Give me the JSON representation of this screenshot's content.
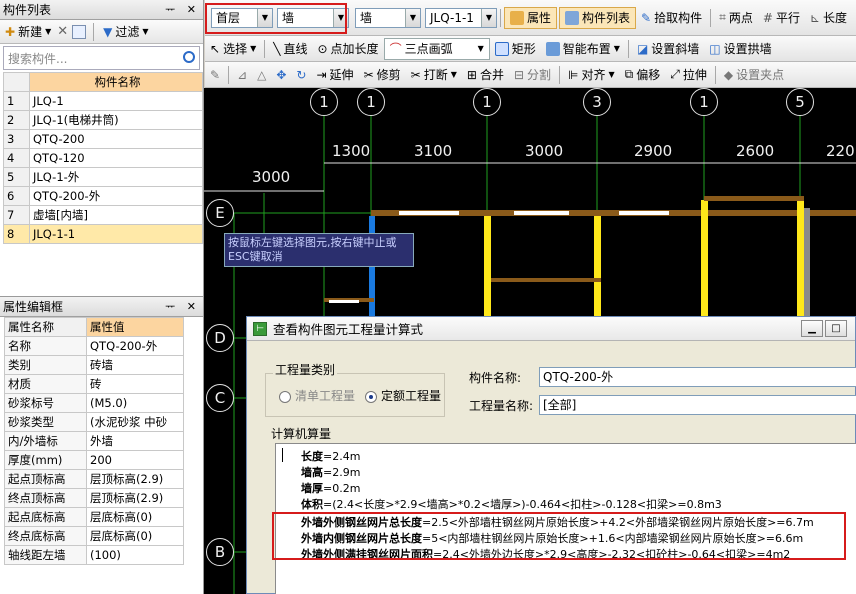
{
  "components_panel": {
    "title": "构件列表",
    "pin": "ᅲ ✕",
    "toolbar": {
      "new_label": "新建",
      "delete_icon": "✕",
      "filter_label": "过滤"
    },
    "search_placeholder": "搜索构件...",
    "column_header": "构件名称",
    "rows": [
      {
        "no": "1",
        "name": "JLQ-1"
      },
      {
        "no": "2",
        "name": "JLQ-1(电梯井筒)"
      },
      {
        "no": "3",
        "name": "QTQ-200"
      },
      {
        "no": "4",
        "name": "QTQ-120"
      },
      {
        "no": "5",
        "name": "JLQ-1-外"
      },
      {
        "no": "6",
        "name": "QTQ-200-外"
      },
      {
        "no": "7",
        "name": "虚墙[内墙]"
      },
      {
        "no": "8",
        "name": "JLQ-1-1"
      }
    ]
  },
  "props_panel": {
    "title": "属性编辑框",
    "pin": "ᅲ ✕",
    "header_name": "属性名称",
    "header_value": "属性值",
    "rows": [
      {
        "name": "名称",
        "value": "QTQ-200-外"
      },
      {
        "name": "类别",
        "value": "砖墙"
      },
      {
        "name": "材质",
        "value": "砖"
      },
      {
        "name": "砂浆标号",
        "value": "(M5.0)"
      },
      {
        "name": "砂浆类型",
        "value": "(水泥砂浆 中砂"
      },
      {
        "name": "内/外墙标",
        "value": "外墙"
      },
      {
        "name": "厚度(mm)",
        "value": "200"
      },
      {
        "name": "起点顶标高",
        "value": "层顶标高(2.9)"
      },
      {
        "name": "终点顶标高",
        "value": "层顶标高(2.9)"
      },
      {
        "name": "起点底标高",
        "value": "层底标高(0)"
      },
      {
        "name": "终点底标高",
        "value": "层底标高(0)"
      },
      {
        "name": "轴线距左墙",
        "value": "(100)"
      }
    ]
  },
  "toolbar1": {
    "floor": "首层",
    "type": "墙",
    "subtype": "墙",
    "component": "JLQ-1-1",
    "attr_btn": "属性",
    "list_btn": "构件列表",
    "pick_btn": "拾取构件",
    "twopoint_btn": "两点",
    "parallel_btn": "平行",
    "length_btn": "长度"
  },
  "toolbar2": {
    "select_btn": "选择",
    "line_btn": "直线",
    "pointlen_btn": "点加长度",
    "arc_btn": "三点画弧",
    "rect_btn": "矩形",
    "smart_btn": "智能布置",
    "slope_btn": "设置斜墙",
    "arch_btn": "设置拱墙"
  },
  "toolbar3": {
    "extend_btn": "延伸",
    "trim_btn": "修剪",
    "break_btn": "打断",
    "merge_btn": "合并",
    "split_btn": "分割",
    "align_btn": "对齐",
    "offset_btn": "偏移",
    "stretch_btn": "拉伸",
    "setpoint_btn": "设置夹点"
  },
  "canvas": {
    "axis_top": [
      "1",
      "1",
      "1",
      "3",
      "1",
      "5"
    ],
    "dims_top": [
      "1300",
      "3100",
      "3000",
      "2900",
      "2600",
      "220"
    ],
    "dim_left": "3000",
    "axis_left": [
      "E",
      "D",
      "C",
      "B"
    ],
    "vertical_dim": "340",
    "tooltip": "按鼠标左键选择图元,按右键中止或ESC键取消"
  },
  "dialog": {
    "title": "查看构件图元工程量计算式",
    "qty_group_label": "工程量类别",
    "radio_list": "清单工程量",
    "radio_quota": "定额工程量",
    "name_label": "构件名称:",
    "name_value": "QTQ-200-外",
    "qty_name_label": "工程量名称:",
    "qty_name_value": "[全部]",
    "calc_label": "计算机算量",
    "calc_lines": [
      {
        "key": "长度",
        "expr": "=2.4m"
      },
      {
        "key": "墙高",
        "expr": "=2.9m"
      },
      {
        "key": "墙厚",
        "expr": "=0.2m"
      },
      {
        "key": "体积",
        "expr": "=(2.4<长度>*2.9<墙高>*0.2<墙厚>)-0.464<扣柱>-0.128<扣梁>=0.8m3"
      },
      {
        "key": "外墙外侧钢丝网片总长度",
        "expr": "=2.5<外部墙柱钢丝网片原始长度>+4.2<外部墙梁钢丝网片原始长度>=6.7m"
      },
      {
        "key": "外墙内侧钢丝网片总长度",
        "expr": "=5<内部墙柱钢丝网片原始长度>+1.6<内部墙梁钢丝网片原始长度>=6.6m"
      },
      {
        "key": "外墙外侧满挂钢丝网片面积",
        "expr": "=2.4<外墙外边长度>*2.9<高度>-2.32<扣砼柱>-0.64<扣梁>=4m2"
      }
    ]
  },
  "colors": {
    "highlight": "#d61b1b",
    "canvas_bg": "#000000",
    "wall_yellow": "#ffe81a",
    "wall_brown": "#8a5a1a",
    "wall_blue": "#1a7ae0"
  }
}
